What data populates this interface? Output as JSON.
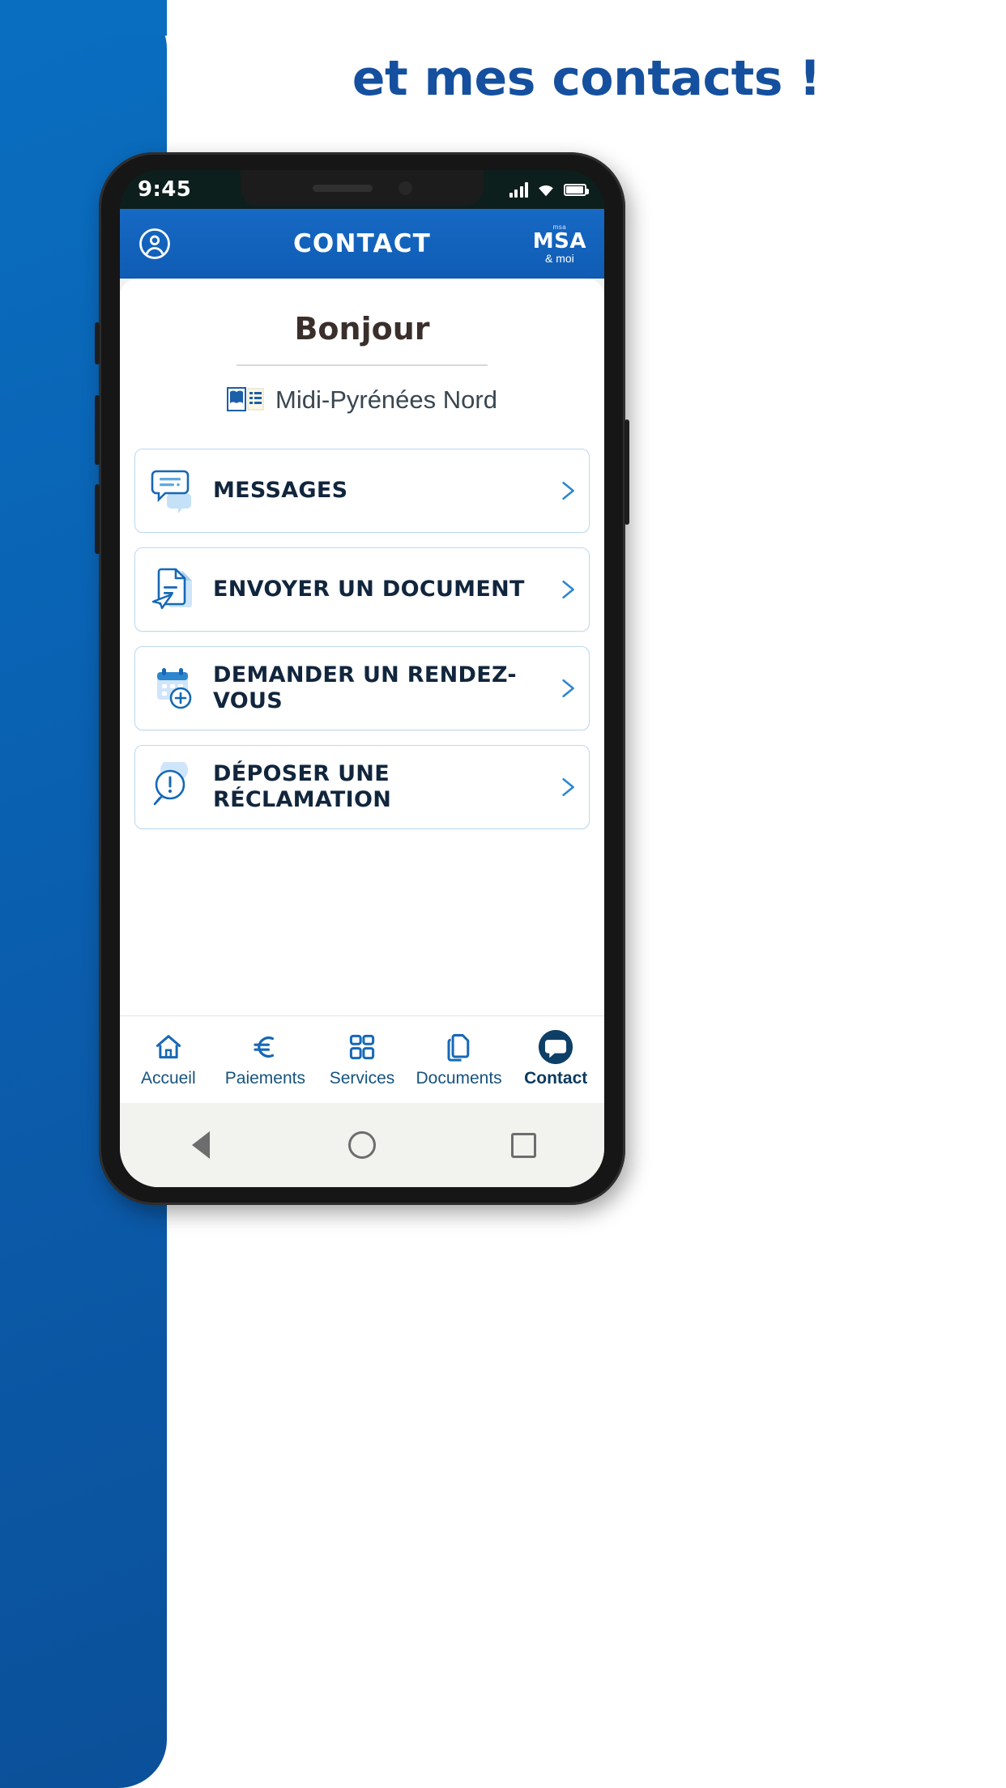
{
  "page": {
    "headline": "et mes contacts !",
    "accent_blue": "#0a63b4",
    "headline_color": "#15509f"
  },
  "phone": {
    "status_bar": {
      "clock": "9:45",
      "signal_icon": "signal-bars-icon",
      "wifi_icon": "wifi-icon",
      "battery_icon": "battery-icon"
    },
    "app_header": {
      "account_icon": "account-circle-icon",
      "title": "CONTACT",
      "logo_tiny": "msa",
      "logo_main": "MSA",
      "logo_sub": "& moi"
    },
    "greeting": "Bonjour",
    "region": {
      "icon": "address-book-icon",
      "label": "Midi-Pyrénées Nord"
    },
    "menu": [
      {
        "icon": "chat-bubbles-icon",
        "label": "MESSAGES",
        "chevron": "chevron-right-icon"
      },
      {
        "icon": "send-document-icon",
        "label": "ENVOYER UN DOCUMENT",
        "chevron": "chevron-right-icon"
      },
      {
        "icon": "calendar-add-icon",
        "label": "DEMANDER UN RENDEZ-VOUS",
        "chevron": "chevron-right-icon"
      },
      {
        "icon": "complaint-bubble-icon",
        "label": "DÉPOSER UNE RÉCLAMATION",
        "chevron": "chevron-right-icon"
      }
    ],
    "bottom_nav": [
      {
        "icon": "home-icon",
        "label": "Accueil",
        "active": false
      },
      {
        "icon": "euro-icon",
        "label": "Paiements",
        "active": false
      },
      {
        "icon": "grid-icon",
        "label": "Services",
        "active": false
      },
      {
        "icon": "documents-icon",
        "label": "Documents",
        "active": false
      },
      {
        "icon": "chat-icon",
        "label": "Contact",
        "active": true
      }
    ],
    "android_nav": {
      "back_icon": "back-triangle-icon",
      "home_icon": "home-circle-icon",
      "recents_icon": "recents-square-icon"
    }
  }
}
